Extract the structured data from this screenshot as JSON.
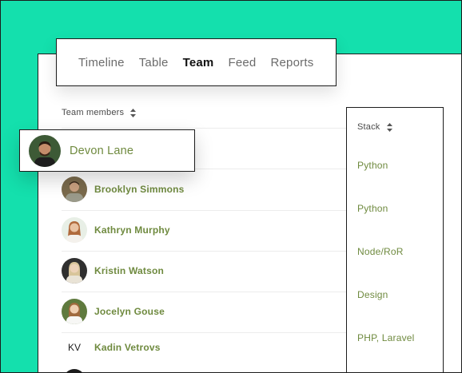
{
  "tabs": [
    {
      "label": "Timeline",
      "active": false
    },
    {
      "label": "Table",
      "active": false
    },
    {
      "label": "Team",
      "active": true
    },
    {
      "label": "Feed",
      "active": false
    },
    {
      "label": "Reports",
      "active": false
    }
  ],
  "columns": {
    "members": "Team members",
    "stack": "Stack"
  },
  "dragged_member": {
    "name": "Devon Lane"
  },
  "members": [
    {
      "name": "Brooklyn Simmons"
    },
    {
      "name": "Kathryn Murphy"
    },
    {
      "name": "Kristin Watson"
    },
    {
      "name": "Jocelyn Gouse"
    },
    {
      "name": "Kadin Vetrovs",
      "initials": "KV"
    }
  ],
  "stack": [
    "Python",
    "Python",
    "Node/RoR",
    "Design",
    "PHP, Laravel"
  ],
  "colors": {
    "background": "#14e0ad",
    "name_text": "#6f8a3f",
    "border": "#1c1c1c"
  }
}
